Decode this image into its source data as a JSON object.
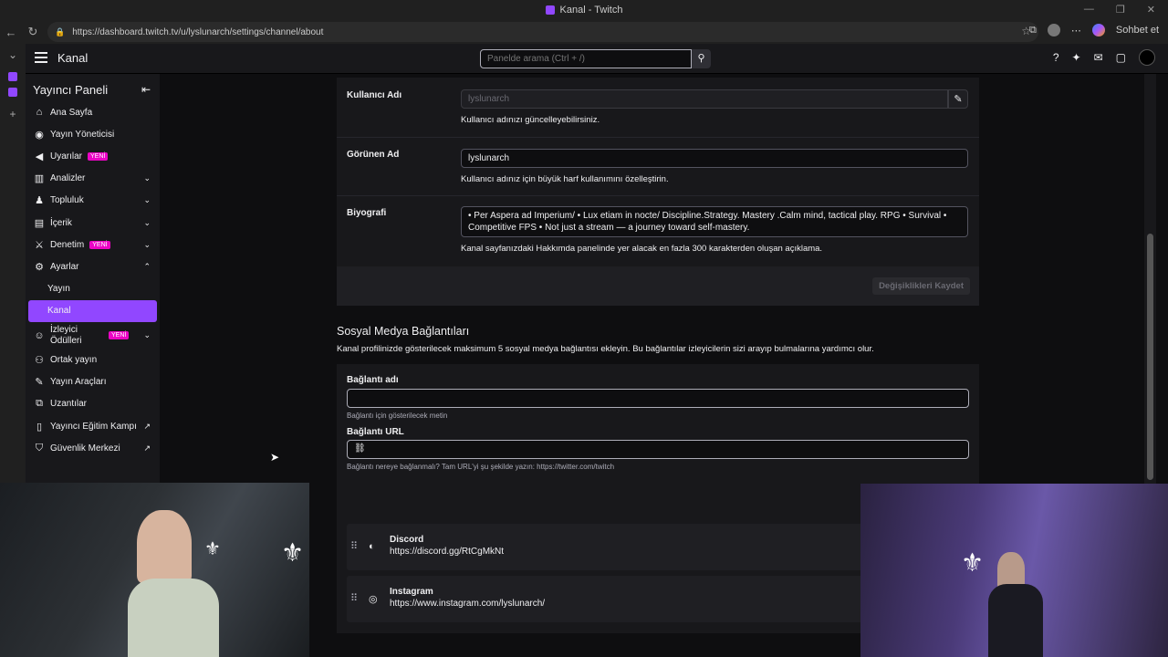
{
  "browser": {
    "tab_title": "Kanal - Twitch",
    "url": "https://dashboard.twitch.tv/u/lyslunarch/settings/channel/about",
    "chat_label": "Sohbet et"
  },
  "topnav": {
    "title": "Kanal",
    "search_placeholder": "Panelde arama (Ctrl + /)"
  },
  "sidebar": {
    "heading": "Yayıncı Paneli",
    "items": [
      {
        "label": "Ana Sayfa",
        "icon": "home-icon"
      },
      {
        "label": "Yayın Yöneticisi",
        "icon": "broadcast-icon"
      },
      {
        "label": "Uyarılar",
        "icon": "megaphone-icon",
        "badge": "YENİ"
      },
      {
        "label": "Analizler",
        "icon": "analytics-icon"
      },
      {
        "label": "Topluluk",
        "icon": "community-icon"
      },
      {
        "label": "İçerik",
        "icon": "content-icon"
      },
      {
        "label": "Denetim",
        "icon": "moderation-icon",
        "badge": "YENİ"
      },
      {
        "label": "Ayarlar",
        "icon": "settings-icon"
      },
      {
        "label": "Yayın"
      },
      {
        "label": "Kanal"
      },
      {
        "label": "İzleyici Ödülleri",
        "icon": "rewards-icon",
        "badge": "YENİ"
      },
      {
        "label": "Ortak yayın",
        "icon": "collab-icon"
      },
      {
        "label": "Yayın Araçları",
        "icon": "tools-icon"
      },
      {
        "label": "Uzantılar",
        "icon": "extensions-icon"
      },
      {
        "label": "Yayıncı Eğitim Kampı",
        "icon": "bootcamp-icon"
      },
      {
        "label": "Güvenlik Merkezi",
        "icon": "shield-icon"
      }
    ]
  },
  "profile": {
    "username_label": "Kullanıcı Adı",
    "username_value": "lyslunarch",
    "username_hint": "Kullanıcı adınızı güncelleyebilirsiniz.",
    "display_label": "Görünen Ad",
    "display_value": "lyslunarch",
    "display_hint": "Kullanıcı adınız için büyük harf kullanımını özelleştirin.",
    "bio_label": "Biyografi",
    "bio_value": "• Per Aspera ad Imperium/  • Lux etiam in nocte/  Discipline.Strategy.  Mastery .Calm mind, tactical play. RPG • Survival • Competitive FPS • Not just a stream — a journey toward self-mastery.",
    "bio_hint": "Kanal sayfanızdaki Hakkımda panelinde yer alacak en fazla 300 karakterden oluşan açıklama.",
    "save_label": "Değişiklikleri Kaydet"
  },
  "social": {
    "heading": "Sosyal Medya Bağlantıları",
    "description": "Kanal profilinizde gösterilecek maksimum 5 sosyal medya bağlantısı ekleyin. Bu bağlantılar izleyicilerin sizi arayıp bulmalarına yardımcı olur.",
    "name_label": "Bağlantı adı",
    "name_value": "",
    "name_hint": "Bağlantı için gösterilecek metin",
    "url_label": "Bağlantı URL",
    "url_value": "",
    "url_hint": "Bağlantı nereye bağlanmalı? Tam URL'yi şu şekilde yazın: https://twitter.com/twitch",
    "links": [
      {
        "name": "Discord",
        "url": "https://discord.gg/RtCgMkNt",
        "icon": "discord-icon"
      },
      {
        "name": "Instagram",
        "url": "https://www.instagram.com/lyslunarch/",
        "icon": "instagram-icon"
      }
    ]
  },
  "colors": {
    "accent": "#9147ff",
    "badge": "#eb04c5",
    "bg": "#0e0e10",
    "panel": "#18181b"
  }
}
